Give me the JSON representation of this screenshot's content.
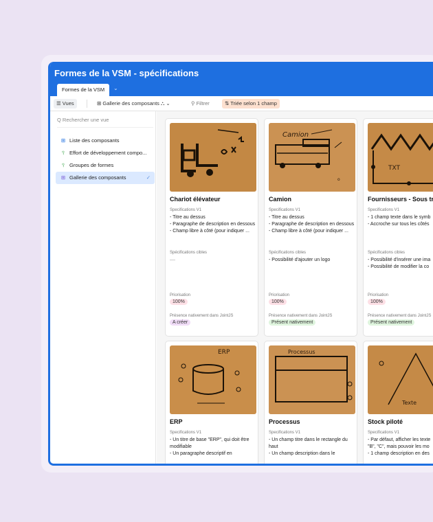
{
  "app": {
    "title": "Formes de la VSM - spécifications",
    "tab": "Formes de la VSM",
    "tab_chevron": "⌄"
  },
  "toolbar": {
    "views_label": "☰ Vues",
    "view_name": "⊞  Gallerie des composants  ⛬  ⌄",
    "filter_label": "⚲ Filtrer",
    "sort_label": "⇅ Triée selon 1 champ"
  },
  "sidebar": {
    "search_placeholder": "Q  Rechercher une vue",
    "items": [
      {
        "icon": "⊞",
        "label": "Liste des composants",
        "color": "#1e6fe0"
      },
      {
        "icon": "⫯",
        "label": "Effort de développement compo...",
        "color": "#2a9d3a"
      },
      {
        "icon": "⫯",
        "label": "Groupes de formes",
        "color": "#2a9d3a"
      },
      {
        "icon": "⊞",
        "label": "Gallerie des composants",
        "color": "#7a5cd6",
        "check": "✓"
      }
    ]
  },
  "cards": [
    {
      "name": "Chariot élévateur",
      "spec_label": "Specifications V1",
      "spec": "- Titre au dessus\n- Paragraphe de description en dessous\n- Champ libre à côté (pour indiquer ...",
      "target_label": "Spécifications cibles",
      "target": "",
      "prio_label": "Priorisation",
      "prio": "100%",
      "presence_label": "Présence nativement dans JointJS",
      "presence": "A créer",
      "presence_style": "purple"
    },
    {
      "name": "Camion",
      "spec_label": "Specifications V1",
      "spec": "- Titre au dessus\n- Paragraphe de description en dessous\n- Champ libre à côté (pour indiquer ...",
      "target_label": "Spécifications cibles",
      "target": "- Possibilité d'ajouter un logo",
      "prio_label": "Priorisation",
      "prio": "100%",
      "presence_label": "Présence nativement dans JointJS",
      "presence": "Présent nativement",
      "presence_style": "green"
    },
    {
      "name": "Fournisseurs - Sous trai",
      "spec_label": "Specifications V1",
      "spec": "- 1 champ texte dans le symb\n- Accroche sur tous les côtés",
      "target_label": "Spécifications cibles",
      "target": "- Possibilité d'insérer une ima\n- Possibilité de modifier la co",
      "prio_label": "Priorisation",
      "prio": "100%",
      "presence_label": "Présence nativement dans JointJS",
      "presence": "Présent nativement",
      "presence_style": "green"
    },
    {
      "name": "ERP",
      "spec_label": "Specifications V1",
      "spec": "- Un titre de base \"ERP\", qui doit être modifiable\n- Un paragraphe descriptif en",
      "sketch_text": "ERP"
    },
    {
      "name": "Processus",
      "spec_label": "Specifications V1",
      "spec": "- Un champ titre dans le rectangle du haut\n- Un champ description dans le",
      "sketch_text": "Processus"
    },
    {
      "name": "Stock piloté",
      "spec_label": "Specifications V1",
      "spec": "- Par défaut, afficher les texte\n\"B\", \"C\", mais pouvoir les mo\n- 1 champ description en des",
      "sketch_text": "Texte"
    }
  ],
  "sketches": {
    "camion_text": "Camion",
    "fournisseur_text": "TXT"
  },
  "colors": {
    "brand_blue": "#1e6fe0",
    "paper": "#c98e4a"
  }
}
